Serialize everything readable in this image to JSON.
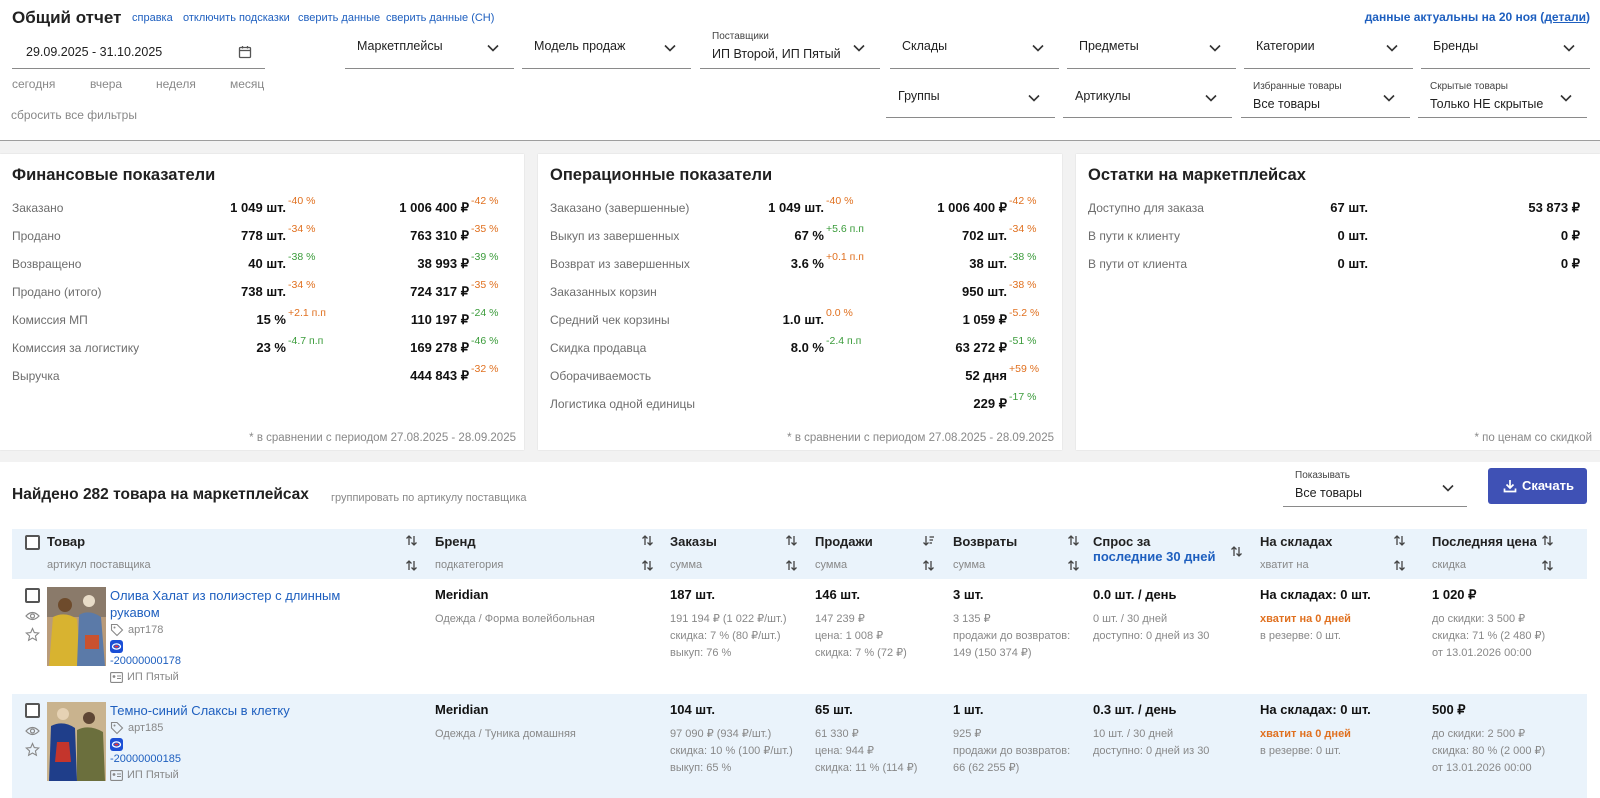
{
  "header": {
    "title": "Общий отчет",
    "links": [
      "справка",
      "отключить подсказки",
      "сверить данные",
      "сверить данные (СН)"
    ],
    "actual_prefix": "данные актуальны на 20 ноя",
    "actual_link": "детали"
  },
  "filters": {
    "date_range": "29.09.2025 - 31.10.2025",
    "quick_dates": [
      "сегодня",
      "вчера",
      "неделя",
      "месяц"
    ],
    "reset": "сбросить все фильтры",
    "marketplaces": "Маркетплейсы",
    "sales_model": "Модель продаж",
    "suppliers_label": "Поставщики",
    "suppliers_value": "ИП Второй, ИП Пятый",
    "warehouses": "Склады",
    "items": "Предметы",
    "categories": "Категории",
    "brands": "Бренды",
    "groups": "Группы",
    "articles": "Артикулы",
    "favorites_label": "Избранные товары",
    "favorites_value": "Все товары",
    "hidden_label": "Скрытые товары",
    "hidden_value": "Только НЕ скрытые"
  },
  "financial": {
    "title": "Финансовые показатели",
    "rows": [
      {
        "label": "Заказано",
        "v1": "1 049 шт.",
        "d1": "-40 %",
        "v2": "1 006 400 ₽",
        "d2": "-42 %"
      },
      {
        "label": "Продано",
        "v1": "778 шт.",
        "d1": "-34 %",
        "v2": "763 310 ₽",
        "d2": "-35 %"
      },
      {
        "label": "Возвращено",
        "v1": "40 шт.",
        "d1": "-38 %",
        "v2": "38 993 ₽",
        "d2": "-39 %"
      },
      {
        "label": "Продано (итого)",
        "v1": "738 шт.",
        "d1": "-34 %",
        "v2": "724 317 ₽",
        "d2": "-35 %"
      },
      {
        "label": "Комиссия МП",
        "v1": "15 %",
        "d1": "+2.1 п.п",
        "v2": "110 197 ₽",
        "d2": "-24 %"
      },
      {
        "label": "Комиссия за логистику",
        "v1": "23 %",
        "d1": "-4.7 п.п",
        "v2": "169 278 ₽",
        "d2": "-46 %"
      },
      {
        "label": "Выручка",
        "v1": "",
        "d1": "",
        "v2": "444 843 ₽",
        "d2": "-32 %"
      }
    ],
    "footnote": "* в сравнении с периодом 27.08.2025 - 28.09.2025"
  },
  "operational": {
    "title": "Операционные показатели",
    "rows": [
      {
        "label": "Заказано (завершенные)",
        "v1": "1 049 шт.",
        "d1": "-40 %",
        "v2": "1 006 400 ₽",
        "d2": "-42 %"
      },
      {
        "label": "Выкуп из завершенных",
        "v1": "67 %",
        "d1": "+5.6 п.п",
        "v2": "702 шт.",
        "d2": "-34 %"
      },
      {
        "label": "Возврат из завершенных",
        "v1": "3.6 %",
        "d1": "+0.1 п.п",
        "v2": "38 шт.",
        "d2": "-38 %"
      },
      {
        "label": "Заказанных корзин",
        "v1": "",
        "d1": "",
        "v2": "950 шт.",
        "d2": "-38 %"
      },
      {
        "label": "Средний чек корзины",
        "v1": "1.0 шт.",
        "d1": "0.0 %",
        "v2": "1 059 ₽",
        "d2": "-5.2 %"
      },
      {
        "label": "Скидка продавца",
        "v1": "8.0 %",
        "d1": "-2.4 п.п",
        "v2": "63 272 ₽",
        "d2": "-51 %"
      },
      {
        "label": "Оборачиваемость",
        "v1": "",
        "d1": "",
        "v2": "52 дня",
        "d2": "+59 %"
      },
      {
        "label": "Логистика одной единицы",
        "v1": "",
        "d1": "",
        "v2": "229 ₽",
        "d2": "-17 %"
      }
    ],
    "footnote": "* в сравнении с периодом 27.08.2025 - 28.09.2025"
  },
  "stocks": {
    "title": "Остатки на маркетплейсах",
    "rows": [
      {
        "label": "Доступно для заказа",
        "v1": "67 шт.",
        "v2": "53 873 ₽"
      },
      {
        "label": "В пути к клиенту",
        "v1": "0 шт.",
        "v2": "0 ₽"
      },
      {
        "label": "В пути от клиента",
        "v1": "0 шт.",
        "v2": "0 ₽"
      }
    ],
    "footnote": "* по ценам со скидкой"
  },
  "list": {
    "found": "Найдено 282 товара на маркетплейсах",
    "group_by": "группировать по артикулу поставщика",
    "show_label": "Показывать",
    "show_value": "Все товары",
    "download": "Скачать"
  },
  "table": {
    "columns": [
      {
        "h1": "Товар",
        "h2": "артикул поставщика"
      },
      {
        "h1": "Бренд",
        "h2": "подкатегория"
      },
      {
        "h1": "Заказы",
        "h2": "сумма"
      },
      {
        "h1": "Продажи",
        "h2": "сумма"
      },
      {
        "h1": "Возвраты",
        "h2": "сумма"
      },
      {
        "h1": "Спрос за",
        "h1b": "последние 30 дней"
      },
      {
        "h1": "На складах",
        "h2": "хватит на"
      },
      {
        "h1": "Последняя цена",
        "h2": "скидка"
      }
    ],
    "rows": [
      {
        "name": "Олива Халат из полиэстер с длинным рукавом",
        "art": "арт178",
        "sku": "-20000000178",
        "seller": "ИП Пятый",
        "brand": "Meridian",
        "subcat": "Одежда / Форма волейбольная",
        "orders": "187 шт.",
        "orders_l1": "191 194 ₽ (1 022 ₽/шт.)",
        "orders_l2": "скидка: 7 % (80 ₽/шт.)",
        "orders_l3": "выкуп: 76 %",
        "sales": "146 шт.",
        "sales_l1": "147 239 ₽",
        "sales_l2": "цена: 1 008 ₽",
        "sales_l3": "скидка: 7 % (72 ₽)",
        "returns": "3 шт.",
        "returns_l1": "3 135 ₽",
        "returns_l2": "продажи до возвратов:",
        "returns_l3": "149 (150 374 ₽)",
        "demand": "0.0 шт. / день",
        "demand_l1": "0 шт. / 30 дней",
        "demand_l2": "доступно: 0 дней из 30",
        "stock": "На складах: 0 шт.",
        "stock_l1": "хватит на 0 дней",
        "stock_l2": "в резерве: 0 шт.",
        "price": "1 020 ₽",
        "price_l1": "до скидки: 3 500 ₽",
        "price_l2": "скидка: 71 % (2 480 ₽)",
        "price_l3": "от 13.01.2026 00:00"
      },
      {
        "name": "Темно-синий Слаксы в клетку",
        "art": "арт185",
        "sku": "-20000000185",
        "seller": "ИП Пятый",
        "brand": "Meridian",
        "subcat": "Одежда / Туника домашняя",
        "orders": "104 шт.",
        "orders_l1": "97 090 ₽ (934 ₽/шт.)",
        "orders_l2": "скидка: 10 % (100 ₽/шт.)",
        "orders_l3": "выкуп: 65 %",
        "sales": "65 шт.",
        "sales_l1": "61 330 ₽",
        "sales_l2": "цена: 944 ₽",
        "sales_l3": "скидка: 11 % (114 ₽)",
        "returns": "1 шт.",
        "returns_l1": "925 ₽",
        "returns_l2": "продажи до возвратов:",
        "returns_l3": "66 (62 255 ₽)",
        "demand": "0.3 шт. / день",
        "demand_l1": "10 шт. / 30 дней",
        "demand_l2": "доступно: 0 дней из 30",
        "stock": "На складах: 0 шт.",
        "stock_l1": "хватит на 0 дней",
        "stock_l2": "в резерве: 0 шт.",
        "price": "500 ₽",
        "price_l1": "до скидки: 2 500 ₽",
        "price_l2": "скидка: 80 % (2 000 ₽)",
        "price_l3": "от 13.01.2026 00:00"
      }
    ]
  }
}
